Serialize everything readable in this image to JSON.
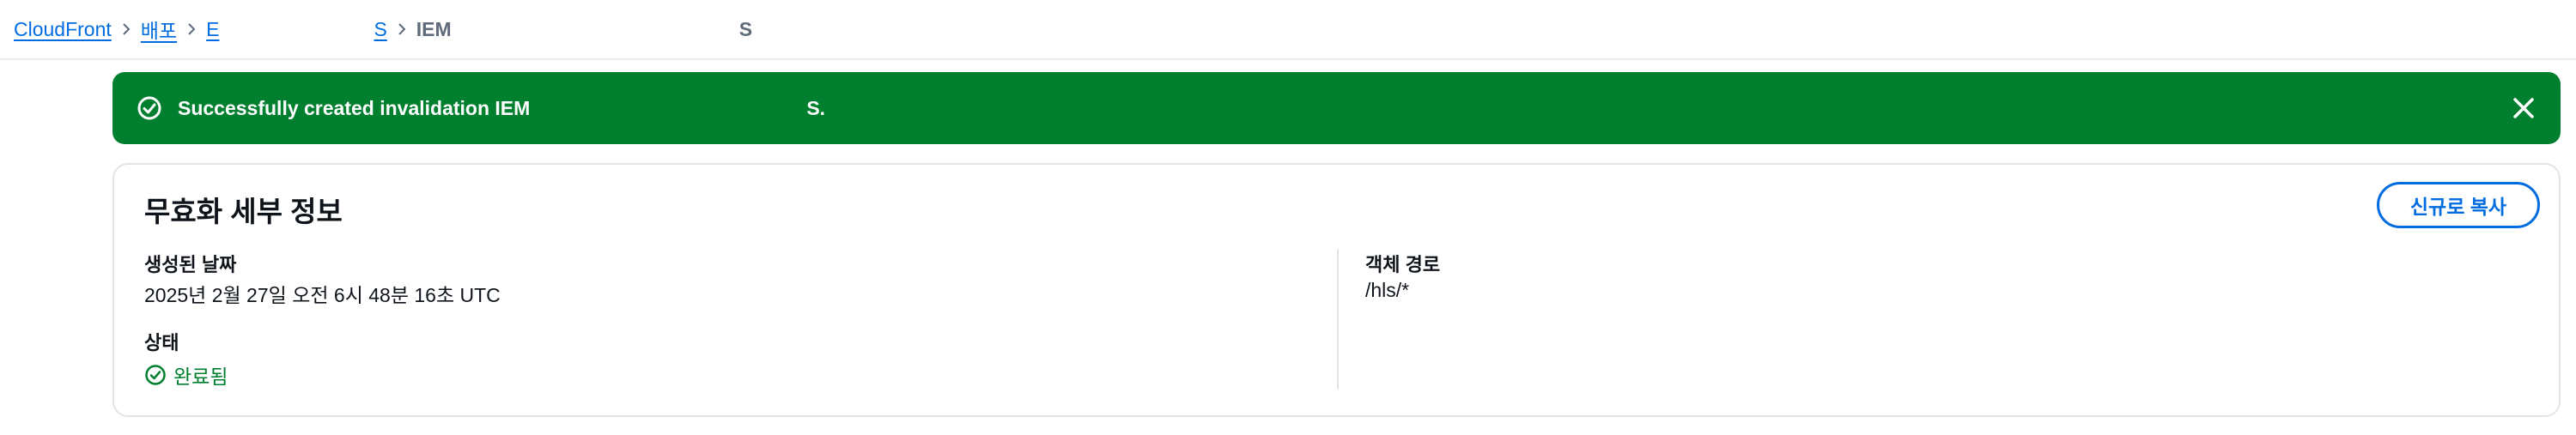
{
  "breadcrumb": {
    "items": [
      {
        "label": "CloudFront"
      },
      {
        "label": "배포"
      },
      {
        "label": "E"
      },
      {
        "label": "S"
      }
    ],
    "current": "IEM",
    "current_suffix": "S"
  },
  "flash": {
    "message": "Successfully created invalidation IEM",
    "message_suffix": "S."
  },
  "details": {
    "title": "무효화 세부 정보",
    "copy_button": "신규로 복사",
    "created_label": "생성된 날짜",
    "created_value": "2025년 2월 27일 오전 6시 48분 16초 UTC",
    "status_label": "상태",
    "status_value": "완료됨",
    "object_path_label": "객체 경로",
    "object_path_value": "/hls/*"
  },
  "colors": {
    "link": "#006ce0",
    "success": "#00802f",
    "text": "#0f141a"
  }
}
